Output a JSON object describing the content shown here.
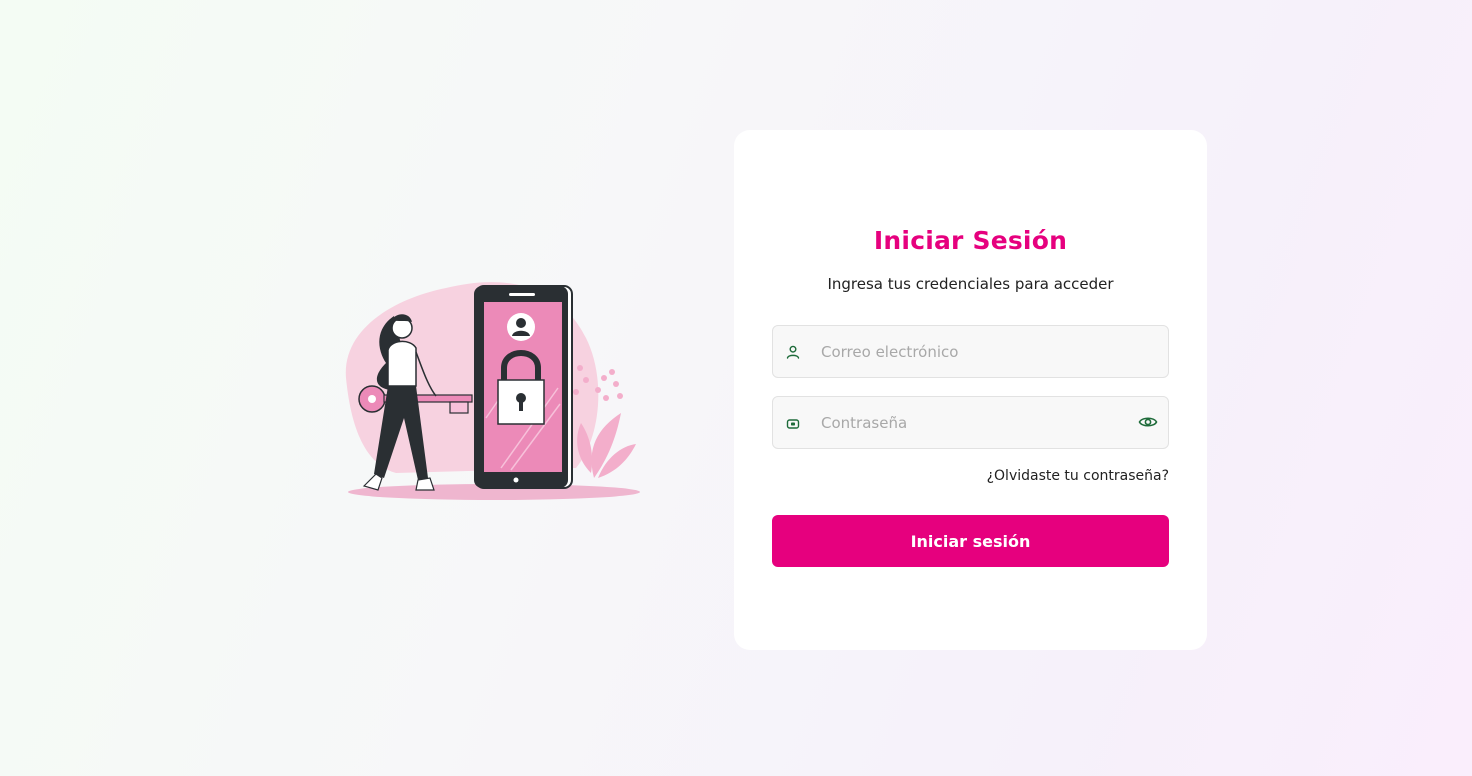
{
  "login": {
    "title": "Iniciar Sesión",
    "subtitle": "Ingresa tus credenciales para acceder",
    "email_placeholder": "Correo electrónico",
    "email_value": "",
    "password_placeholder": "Contraseña",
    "password_value": "",
    "forgot_label": "¿Olvidaste tu contraseña?",
    "submit_label": "Iniciar sesión"
  },
  "icons": {
    "email": "user-icon",
    "password": "lock-icon",
    "toggle": "eye-icon"
  },
  "colors": {
    "brand": "#e6007e",
    "icon": "#1e6b3a",
    "card": "#ffffff"
  }
}
